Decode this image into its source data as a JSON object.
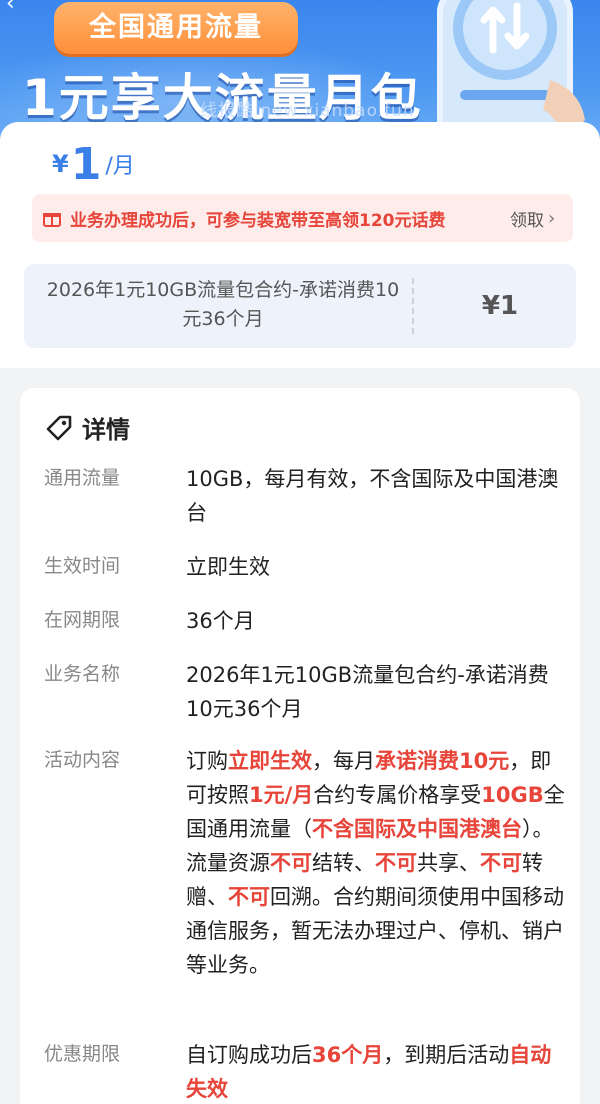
{
  "banner": {
    "pill_label": "全国通用流量",
    "headline": "1元享大流量月包",
    "watermark": "线报酷 new.xianbao.fun"
  },
  "price": {
    "currency": "¥",
    "amount": "1",
    "unit": "/月"
  },
  "promo": {
    "text": "业务办理成功后，可参与装宽带至高领120元话费",
    "link_label": "领取"
  },
  "plan": {
    "name": "2026年1元10GB流量包合约-承诺消费10元36个月",
    "price": "¥1"
  },
  "details": {
    "title": "详情",
    "rows": [
      {
        "label": "通用流量",
        "value": "10GB，每月有效，不含国际及中国港澳台"
      },
      {
        "label": "生效时间",
        "value": "立即生效"
      },
      {
        "label": "在网期限",
        "value": "36个月"
      },
      {
        "label": "业务名称",
        "value": "2026年1元10GB流量包合约-承诺消费10元36个月"
      },
      {
        "label": "活动内容",
        "segments": [
          {
            "t": "订购",
            "h": false
          },
          {
            "t": "立即生效",
            "h": true
          },
          {
            "t": "，每月",
            "h": false
          },
          {
            "t": "承诺消费10元",
            "h": true
          },
          {
            "t": "，即可按照",
            "h": false
          },
          {
            "t": "1元/月",
            "h": true
          },
          {
            "t": "合约专属价格享受",
            "h": false
          },
          {
            "t": "10GB",
            "h": true
          },
          {
            "t": "全国通用流量（",
            "h": false
          },
          {
            "t": "不含国际及中国港澳台",
            "h": true
          },
          {
            "t": "）。流量资源",
            "h": false
          },
          {
            "t": "不可",
            "h": true
          },
          {
            "t": "结转、",
            "h": false
          },
          {
            "t": "不可",
            "h": true
          },
          {
            "t": "共享、",
            "h": false
          },
          {
            "t": "不可",
            "h": true
          },
          {
            "t": "转赠、",
            "h": false
          },
          {
            "t": "不可",
            "h": true
          },
          {
            "t": "回溯。合约期间须使用中国移动通信服务，暂无法办理过户、停机、销户等业务。",
            "h": false
          }
        ]
      },
      {
        "label": "优惠期限",
        "segments": [
          {
            "t": "自订购成功后",
            "h": false
          },
          {
            "t": "36个月",
            "h": true
          },
          {
            "t": "，到期后活动",
            "h": false
          },
          {
            "t": "自动失效",
            "h": true
          }
        ]
      }
    ]
  },
  "colors": {
    "accent_blue": "#3a7ee8",
    "highlight_red": "#e7443a",
    "banner_orange": "#ff8f3a"
  },
  "icons": {
    "back": "back-arrow-icon",
    "gift": "gift-icon",
    "chevron": "chevron-right-icon",
    "tag": "tag-icon"
  }
}
